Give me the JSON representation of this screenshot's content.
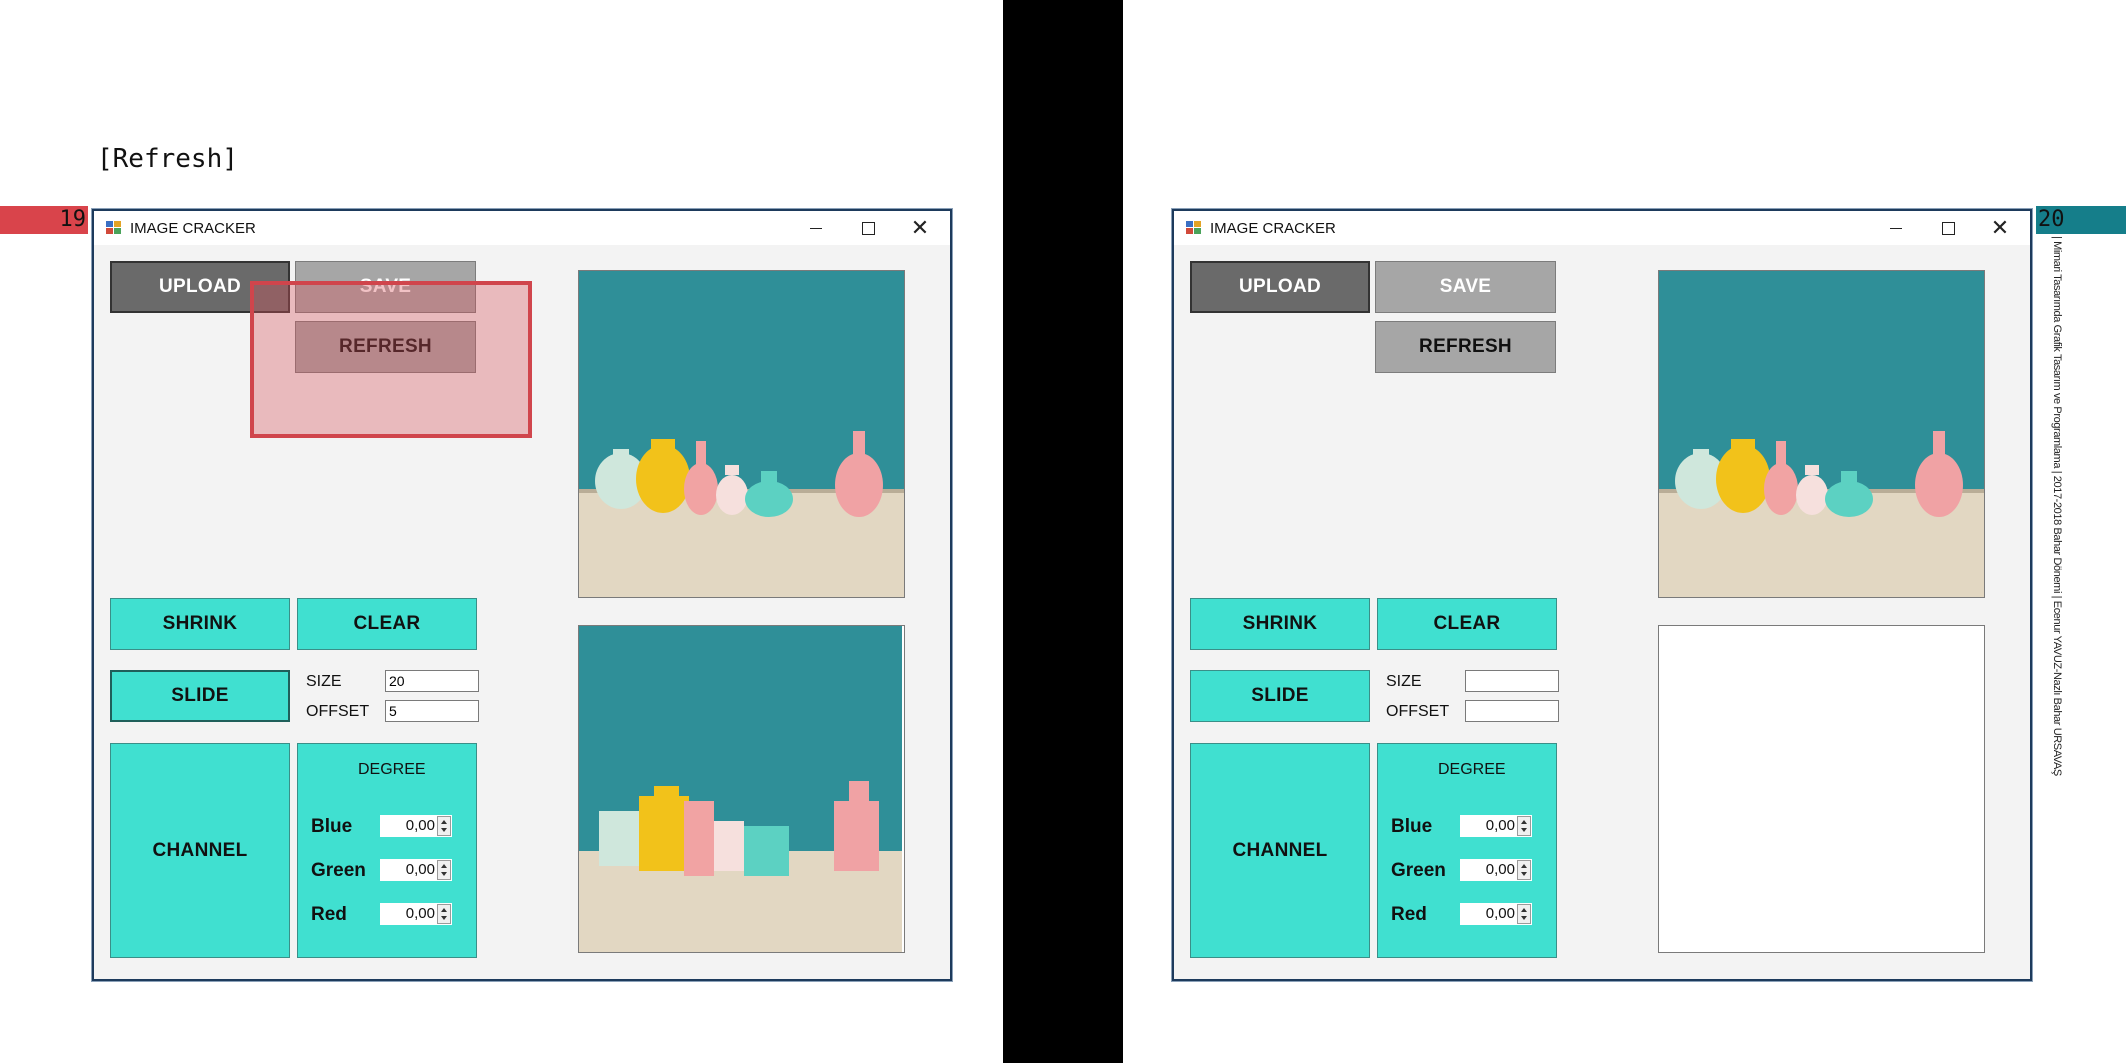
{
  "caption": "[Refresh]",
  "page_numbers": {
    "left": "19",
    "right": "20"
  },
  "side_credit": "| Mimari Tasarımda Grafik Tasarım ve Programlama | 2017-2018 Bahar Dönemi | Ecenur YAVUZ-Nazlı Bahar URSAVAŞ",
  "colors": {
    "teal": "#40e0d0",
    "dark_button": "#6a6a6a",
    "gray_button": "#a6a6a6",
    "highlight": "#d0454c",
    "wall": "#2f8f98"
  },
  "window": {
    "title": "IMAGE CRACKER",
    "controls": {
      "minimize": "minimize-icon",
      "maximize": "maximize-icon",
      "close": "✕"
    }
  },
  "buttons": {
    "upload": "UPLOAD",
    "save": "SAVE",
    "refresh": "REFRESH",
    "shrink": "SHRINK",
    "clear": "CLEAR",
    "slide": "SLIDE",
    "channel": "CHANNEL"
  },
  "fields": {
    "size_label": "SIZE",
    "offset_label": "OFFSET",
    "degree_label": "DEGREE",
    "blue_label": "Blue",
    "green_label": "Green",
    "red_label": "Red"
  },
  "left_state": {
    "size": "20",
    "offset": "5",
    "blue": "0,00",
    "green": "0,00",
    "red": "0,00"
  },
  "right_state": {
    "size": "",
    "offset": "",
    "blue": "0,00",
    "green": "0,00",
    "red": "0,00"
  }
}
